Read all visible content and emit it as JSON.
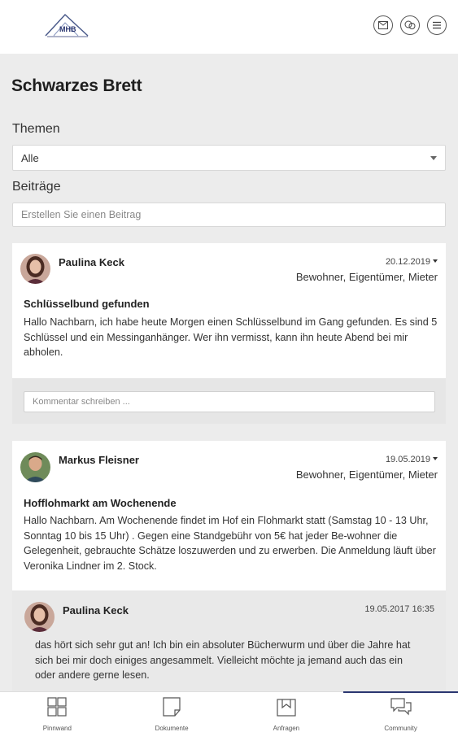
{
  "header": {
    "logo_text": "MHB",
    "icons": [
      "mail-icon",
      "chat-icon",
      "menu-icon"
    ]
  },
  "page": {
    "title": "Schwarzes Brett",
    "themes_label": "Themen",
    "themes_selected": "Alle",
    "posts_label": "Beiträge",
    "create_placeholder": "Erstellen Sie einen Beitrag"
  },
  "posts": [
    {
      "author": "Paulina Keck",
      "date": "20.12.2019",
      "audience": "Bewohner, Eigentümer, Mieter",
      "title": "Schlüsselbund gefunden",
      "body": "Hallo Nachbarn, ich habe heute Morgen einen Schlüsselbund im Gang gefunden. Es sind 5 Schlüssel und ein Messinganhänger. Wer ihn vermisst, kann ihn heute Abend bei mir abholen.",
      "comment_placeholder": "Kommentar schreiben ..."
    },
    {
      "author": "Markus Fleisner",
      "date": "19.05.2019",
      "audience": "Bewohner, Eigentümer, Mieter",
      "title": "Hofflohmarkt am Wochenende",
      "body": "Hallo Nachbarn. Am Wochenende findet im Hof ein Flohmarkt statt (Samstag 10 - 13 Uhr, Sonntag 10 bis 15 Uhr) . Gegen eine Standgebühr von 5€ hat jeder Be-wohner die Gelegenheit, gebrauchte Schätze loszuwerden und zu erwerben. Die Anmeldung läuft über Veronika Lindner im 2. Stock."
    }
  ],
  "reply": {
    "author": "Paulina Keck",
    "date": "19.05.2017 16:35",
    "body": "das hört sich sehr gut an! Ich bin ein absoluter Bücherwurm und über die Jahre hat sich bei mir doch einiges angesammelt. Vielleicht möchte ja jemand auch das ein oder andere gerne lesen."
  },
  "nav": [
    {
      "label": "Pinnwand",
      "icon": "grid-icon",
      "active": false
    },
    {
      "label": "Dokumente",
      "icon": "document-icon",
      "active": false
    },
    {
      "label": "Anfragen",
      "icon": "inbox-icon",
      "active": false
    },
    {
      "label": "Community",
      "icon": "community-chat-icon",
      "active": true
    }
  ],
  "colors": {
    "accent": "#2a3670",
    "background": "#ececec",
    "card": "#ffffff"
  }
}
